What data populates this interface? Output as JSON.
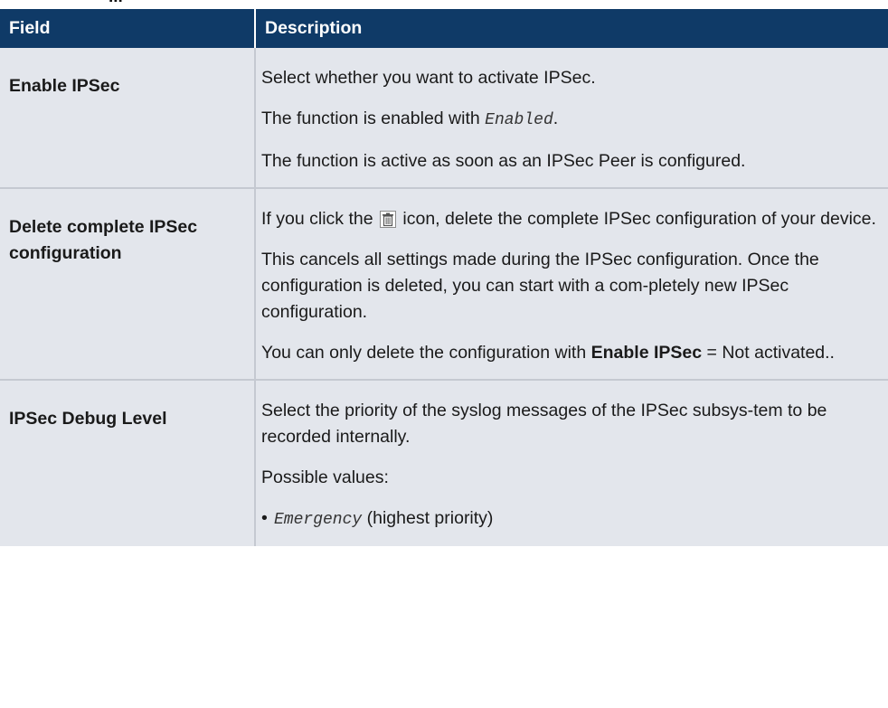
{
  "heading_fragment": "...",
  "table": {
    "col_field": "Field",
    "col_description": "Description",
    "rows": [
      {
        "field": "Enable IPSec",
        "p1": "Select whether you want to activate IPSec.",
        "p2_a": "The function is enabled with ",
        "p2_code": "Enabled",
        "p2_b": ".",
        "p3": "The function is active as soon as an IPSec Peer is configured."
      },
      {
        "field_line1": "Delete complete IPSec",
        "field_line2": "configuration",
        "p1_a": "If you click the ",
        "p1_b": " icon, delete the complete IPSec configuration of your device.",
        "p2": "This cancels all settings made during the IPSec configuration. Once the configuration is deleted, you can start with a com-pletely new IPSec configuration.",
        "p3_a": "You can only delete the configuration with ",
        "p3_bold": "Enable IPSec",
        "p3_b": " = Not activated.."
      },
      {
        "field": "IPSec Debug Level",
        "p1": "Select the priority of the syslog messages of the IPSec subsys-tem to be recorded internally.",
        "p2": "Possible values:",
        "bullet_code": "Emergency",
        "bullet_text": " (highest priority)"
      }
    ]
  },
  "icons": {
    "delete": "trash-icon"
  },
  "colors": {
    "header_bg": "#0f3a67",
    "row_bg": "#e3e6ec"
  }
}
